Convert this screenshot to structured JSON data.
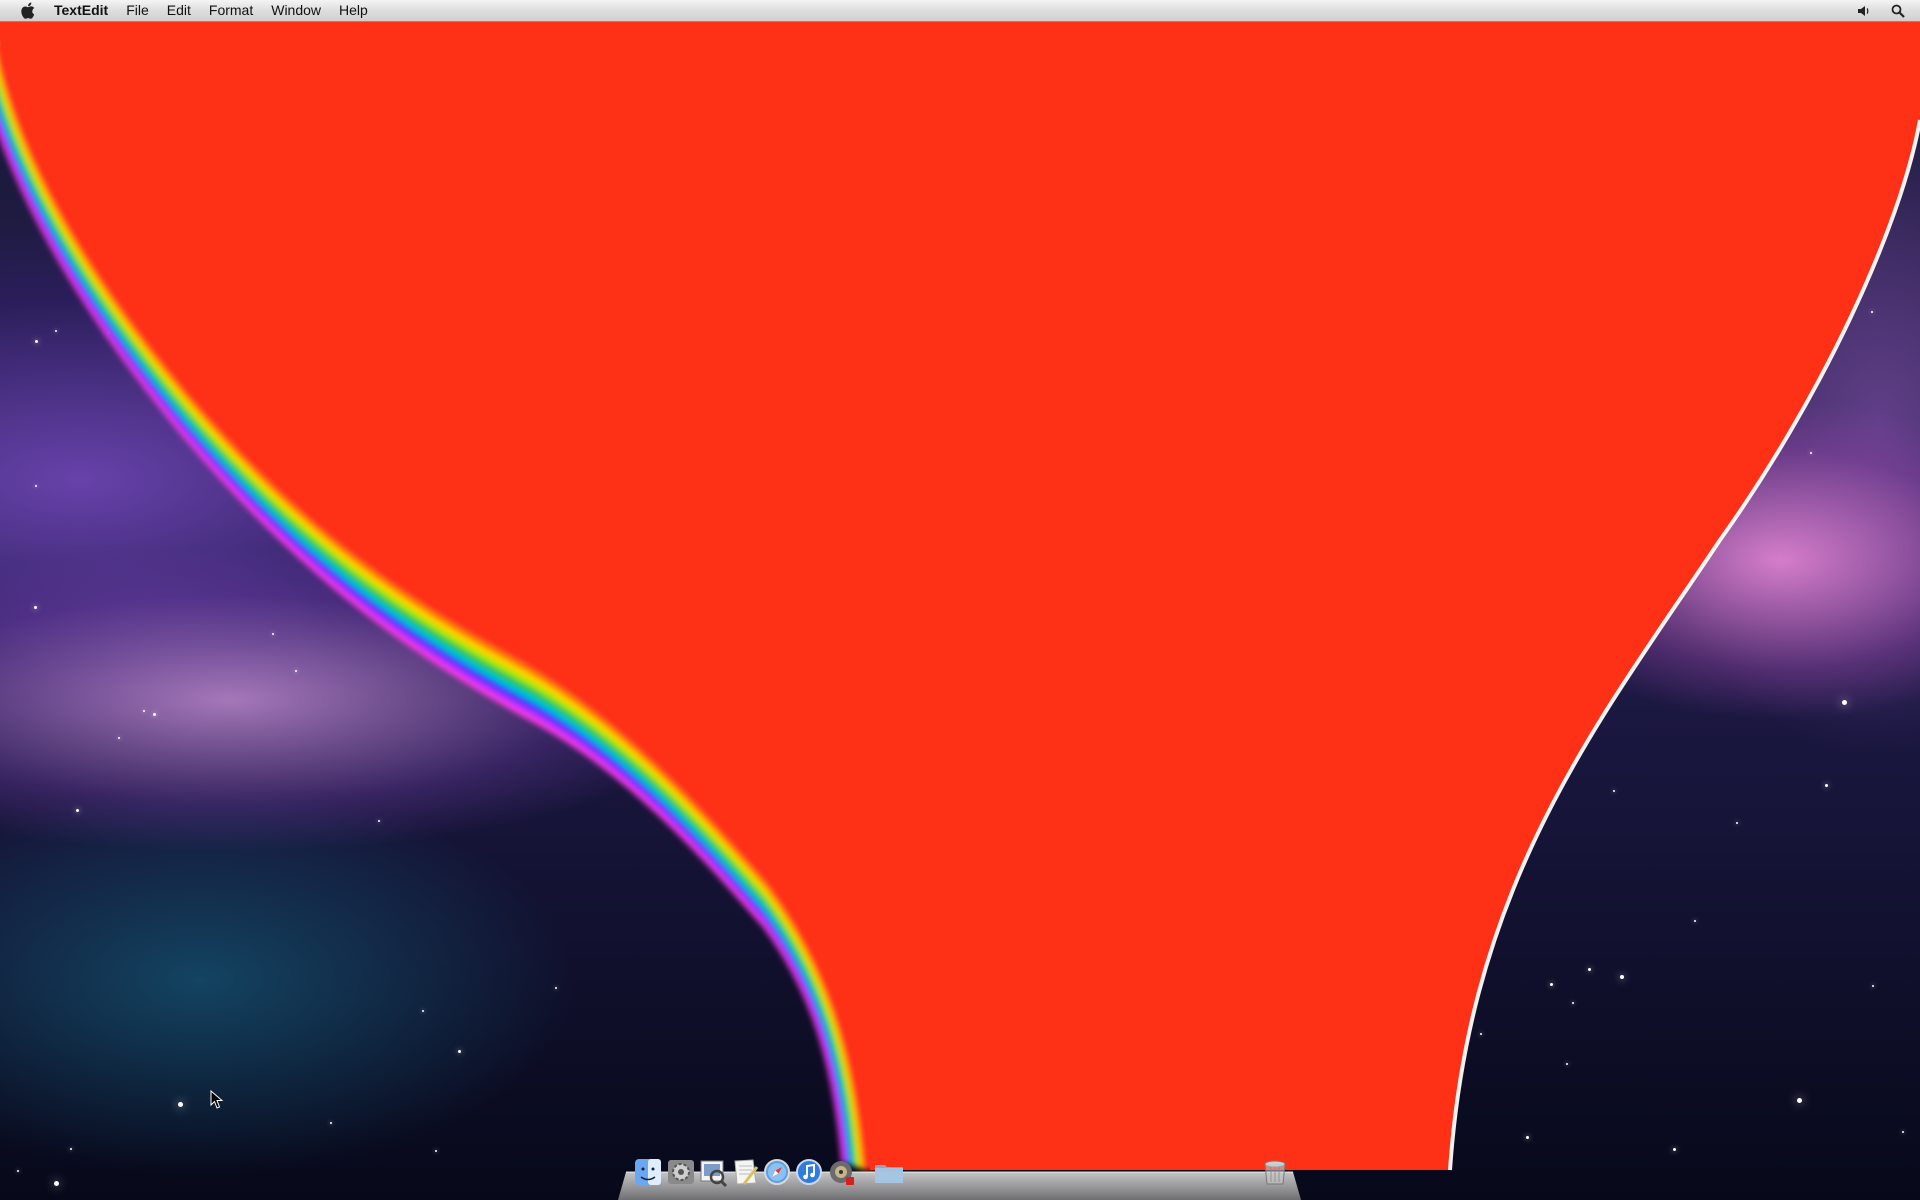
{
  "menubar": {
    "apple_icon": "apple-logo-icon",
    "app_name": "TextEdit",
    "menus": [
      "File",
      "Edit",
      "Format",
      "Window",
      "Help"
    ],
    "right_icons": [
      "volume-icon",
      "spotlight-search-icon"
    ]
  },
  "canvas": {
    "fill_color": "#fe3116",
    "rainbow_colors": [
      "#ff2a1a",
      "#ff7a00",
      "#ffd400",
      "#9bea00",
      "#17c24a",
      "#00c8d2",
      "#0b3cff",
      "#9a2cff",
      "#ff3be6"
    ]
  },
  "dock": {
    "apps": [
      "finder-icon",
      "system-preferences-icon",
      "preview-icon",
      "textedit-icon",
      "safari-icon",
      "itunes-icon",
      "dvd-player-icon",
      "documents-folder-icon"
    ],
    "trash": "trash-icon"
  }
}
